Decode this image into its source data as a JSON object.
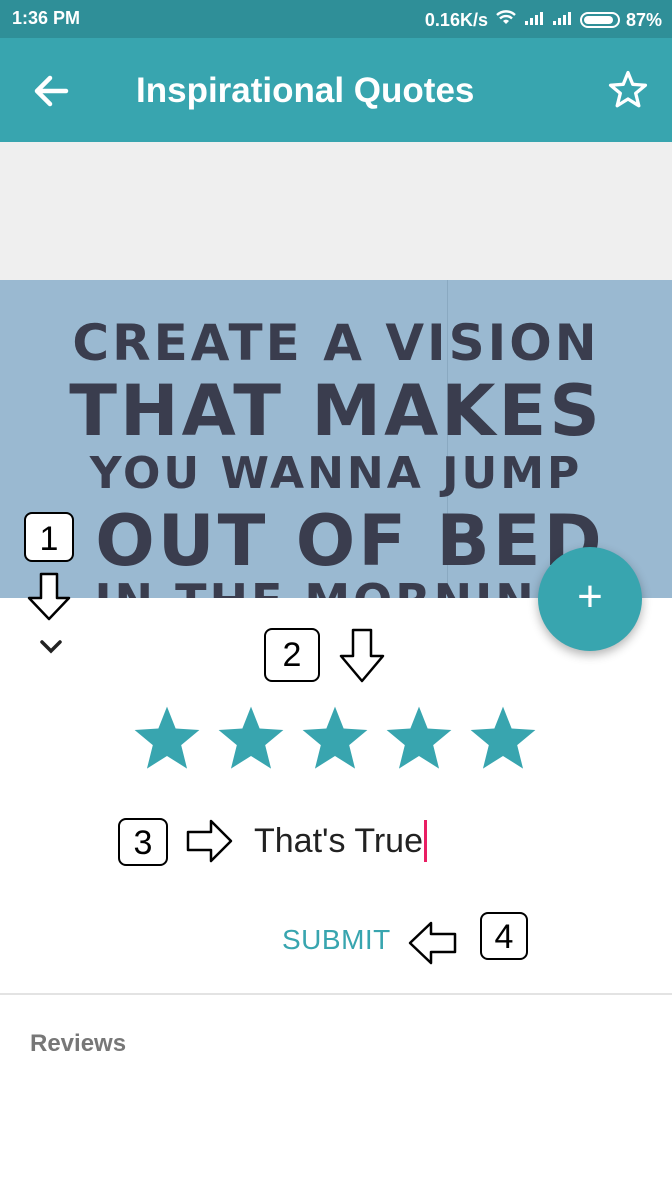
{
  "status_bar": {
    "time": "1:36 PM",
    "network_speed": "0.16K/s",
    "battery_percent": "87%"
  },
  "app_bar": {
    "title": "Inspirational Quotes",
    "back_icon": "arrow-left-icon",
    "favorite_icon": "star-outline-icon"
  },
  "quote_image": {
    "lines": [
      "CREATE A VISION",
      "THAT MAKES",
      "YOU WANNA JUMP",
      "OUT OF BED",
      "IN THE MORNING"
    ]
  },
  "fab": {
    "label": "+"
  },
  "annotations": [
    "1",
    "2",
    "3",
    "4"
  ],
  "rating": {
    "value": 5,
    "max": 5,
    "color": "#38a5af"
  },
  "review": {
    "value": "That's True"
  },
  "submit": {
    "label": "SUBMIT"
  },
  "reviews_section": {
    "label": "Reviews"
  },
  "colors": {
    "primary": "#38a5af",
    "status_bar": "#2f8f98",
    "accent": "#e91e63"
  }
}
